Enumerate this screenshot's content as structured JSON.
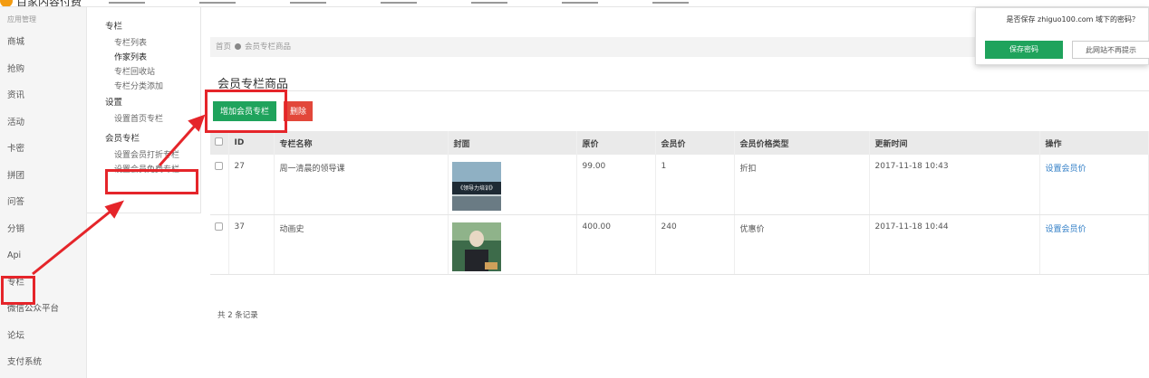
{
  "topbar": {
    "logo_text": "百家内容付费"
  },
  "sidebar": {
    "title": "应用管理",
    "items": [
      {
        "label": "商城"
      },
      {
        "label": "抢购"
      },
      {
        "label": "资讯"
      },
      {
        "label": "活动"
      },
      {
        "label": "卡密"
      },
      {
        "label": "拼团"
      },
      {
        "label": "问答"
      },
      {
        "label": "分销"
      },
      {
        "label": "Api"
      },
      {
        "label": "专栏"
      },
      {
        "label": "微信公众平台"
      },
      {
        "label": "论坛"
      },
      {
        "label": "支付系统"
      }
    ]
  },
  "subnav": {
    "group1": {
      "head": "专栏",
      "items": [
        "专栏列表",
        "作家列表",
        "专栏回收站",
        "专栏分类添加"
      ]
    },
    "group2": {
      "head": "设置",
      "items": [
        "设置首页专栏"
      ]
    },
    "group3": {
      "head": "会员专栏",
      "items": [
        "设置会员打折专栏",
        "设置会员免费专栏"
      ]
    }
  },
  "breadcrumb": {
    "home": "首页",
    "current": "会员专栏商品"
  },
  "page_title": "会员专栏商品",
  "buttons": {
    "add": "增加会员专栏",
    "delete": "删除"
  },
  "table": {
    "headers": [
      "ID",
      "专栏名称",
      "封面",
      "原价",
      "会员价",
      "会员价格类型",
      "更新时间",
      "操作"
    ],
    "rows": [
      {
        "id": "27",
        "name": "周一清晨的领导课",
        "price": "99.00",
        "member_price": "1",
        "price_type": "折扣",
        "updated": "2017-11-18 10:43",
        "action": "设置会员价",
        "cover_text": "《领导力培训》"
      },
      {
        "id": "37",
        "name": "动画史",
        "price": "400.00",
        "member_price": "240",
        "price_type": "优惠价",
        "updated": "2017-11-18 10:44",
        "action": "设置会员价"
      }
    ]
  },
  "footer": {
    "count_text": "共 2 条记录"
  },
  "password_popup": {
    "question": "是否保存 zhiguo100.com 域下的密码？",
    "save": "保存密码",
    "never": "此网站不再提示"
  },
  "colors": {
    "primary_green": "#1fa35c",
    "danger_red": "#e2473a",
    "annotation_red": "#e5252a",
    "link_blue": "#2f7dc6"
  }
}
